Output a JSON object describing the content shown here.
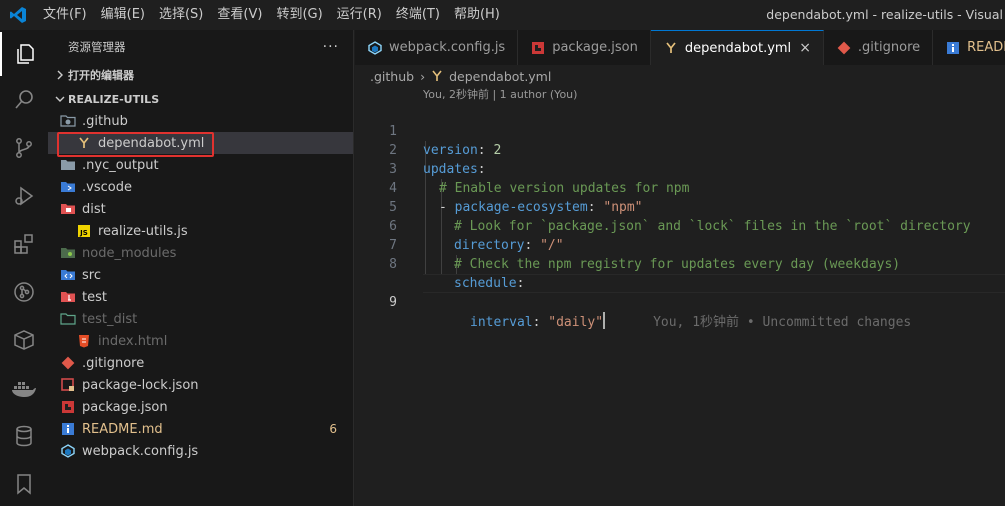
{
  "menu": [
    "文件(F)",
    "编辑(E)",
    "选择(S)",
    "查看(V)",
    "转到(G)",
    "运行(R)",
    "终端(T)",
    "帮助(H)"
  ],
  "window_title": "dependabot.yml - realize-utils - Visual",
  "activity_icons": [
    "explorer-icon",
    "search-icon",
    "source-control-icon",
    "run-debug-icon",
    "extensions-icon",
    "git-graph-icon",
    "package-icon",
    "docker-icon",
    "database-icon",
    "bookmark-icon"
  ],
  "sidebar": {
    "title": "资源管理器",
    "more": "···",
    "open_editors": "打开的编辑器",
    "project": "REALIZE-UTILS",
    "items": [
      {
        "label": ".github",
        "type": "folder-github",
        "indent": 0,
        "state": "normal"
      },
      {
        "label": "dependabot.yml",
        "type": "yaml",
        "indent": 1,
        "state": "selected"
      },
      {
        "label": ".nyc_output",
        "type": "folder",
        "indent": 0,
        "state": "normal"
      },
      {
        "label": ".vscode",
        "type": "folder-vscode",
        "indent": 0,
        "state": "normal"
      },
      {
        "label": "dist",
        "type": "folder-dist",
        "indent": 0,
        "state": "normal"
      },
      {
        "label": "realize-utils.js",
        "type": "js",
        "indent": 1,
        "state": "normal"
      },
      {
        "label": "node_modules",
        "type": "folder-node",
        "indent": 0,
        "state": "dim"
      },
      {
        "label": "src",
        "type": "folder-src",
        "indent": 0,
        "state": "normal"
      },
      {
        "label": "test",
        "type": "folder-test",
        "indent": 0,
        "state": "normal"
      },
      {
        "label": "test_dist",
        "type": "folder-outline",
        "indent": 0,
        "state": "dim"
      },
      {
        "label": "index.html",
        "type": "html",
        "indent": 1,
        "state": "dim"
      },
      {
        "label": ".gitignore",
        "type": "git",
        "indent": 0,
        "state": "normal"
      },
      {
        "label": "package-lock.json",
        "type": "lock",
        "indent": 0,
        "state": "normal"
      },
      {
        "label": "package.json",
        "type": "npm",
        "indent": 0,
        "state": "normal"
      },
      {
        "label": "README.md",
        "type": "info",
        "indent": 0,
        "state": "modified",
        "badge": "6"
      },
      {
        "label": "webpack.config.js",
        "type": "webpack",
        "indent": 0,
        "state": "normal"
      }
    ]
  },
  "tabs": [
    {
      "label": "webpack.config.js",
      "type": "webpack",
      "active": false
    },
    {
      "label": "package.json",
      "type": "npm",
      "active": false
    },
    {
      "label": "dependabot.yml",
      "type": "yaml",
      "active": true
    },
    {
      "label": ".gitignore",
      "type": "git",
      "active": false
    },
    {
      "label": "README",
      "type": "info",
      "active": false,
      "modified": true
    }
  ],
  "tab_close": "×",
  "breadcrumb": [
    ".github",
    "dependabot.yml"
  ],
  "codelens": "You, 2秒钟前 | 1 author (You)",
  "code": {
    "line_numbers": [
      "1",
      "2",
      "3",
      "4",
      "5",
      "6",
      "7",
      "8",
      "9"
    ],
    "l1_key": "version",
    "l1_colon": ": ",
    "l1_val": "2",
    "l2_key": "updates",
    "l2_colon": ":",
    "l3_comment": "# Enable version updates for npm",
    "l4_dash": "- ",
    "l4_key": "package-ecosystem",
    "l4_colon": ": ",
    "l4_val": "\"npm\"",
    "l5_comment": "# Look for `package.json` and `lock` files in the `root` directory",
    "l6_key": "directory",
    "l6_colon": ": ",
    "l6_val": "\"/\"",
    "l7_comment": "# Check the npm registry for updates every day (weekdays)",
    "l8_key": "schedule",
    "l8_colon": ":",
    "l9_key": "interval",
    "l9_colon": ": ",
    "l9_val": "\"daily\"",
    "blame": "You, 1秒钟前 • Uncommitted changes"
  },
  "colors": {
    "accent": "#0078d4",
    "highlight_box": "#e0322f",
    "modified": "#e2c08d"
  }
}
